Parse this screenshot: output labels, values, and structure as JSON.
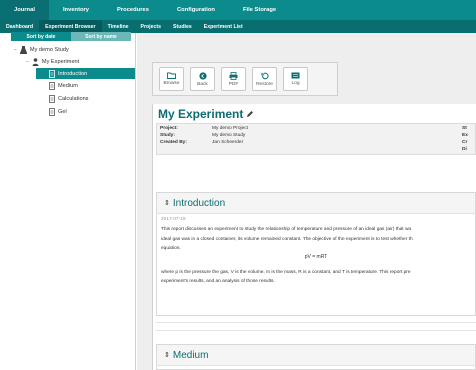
{
  "top_tabs": [
    "Journal",
    "Inventory",
    "Procedures",
    "Configuration",
    "File Storage"
  ],
  "sub_tabs": [
    "Dashboard",
    "Experiment Browser",
    "Timeline",
    "Projects",
    "Studies",
    "Experiment List"
  ],
  "sidebar": {
    "sort_by_date": "Sort by date",
    "sort_by_name": "Sort by name",
    "study": "My demo Study",
    "experiment": "My Experiment",
    "items": [
      "Introduction",
      "Medium",
      "Calculations",
      "Gel"
    ]
  },
  "toolbar": {
    "buttons": [
      {
        "icon": "folder-icon",
        "label": "Browse"
      },
      {
        "icon": "back-icon",
        "label": "Back"
      },
      {
        "icon": "print-icon",
        "label": "PDF"
      },
      {
        "icon": "restore-icon",
        "label": "Restore"
      },
      {
        "icon": "log-icon",
        "label": "Log"
      }
    ]
  },
  "experiment": {
    "title": "My Experiment",
    "project_label": "Project:",
    "project": "My demo Project",
    "study_label": "Study:",
    "study": "My demo Study",
    "created_label": "Created By:",
    "created_by": "Jan Scheerder",
    "right_labels": [
      "St",
      "Ex",
      "Cr",
      "Di"
    ]
  },
  "sections": {
    "intro_title": "Introduction",
    "intro_date": "2017-07-19",
    "intro_line1": "This report discusses an experiment to study the relationship of temperature and pressure of an ideal gas (air) that wa",
    "intro_line2": "ideal gas was in a closed container, its volume remained constant. The objective of the experiment is to test whether th",
    "intro_line3": "equation,",
    "formula": "pV = mRT",
    "intro_line4": "where p is the pressure the gas, V is the volume, m is the mass, R is a constant, and T is temperature. This report pre",
    "intro_line5": "experiment's results, and an analysis of those results.",
    "medium_title": "Medium"
  },
  "colors": {
    "teal": "#0c8b8c",
    "dark_teal": "#086e70",
    "title_teal": "#0b6d72"
  }
}
